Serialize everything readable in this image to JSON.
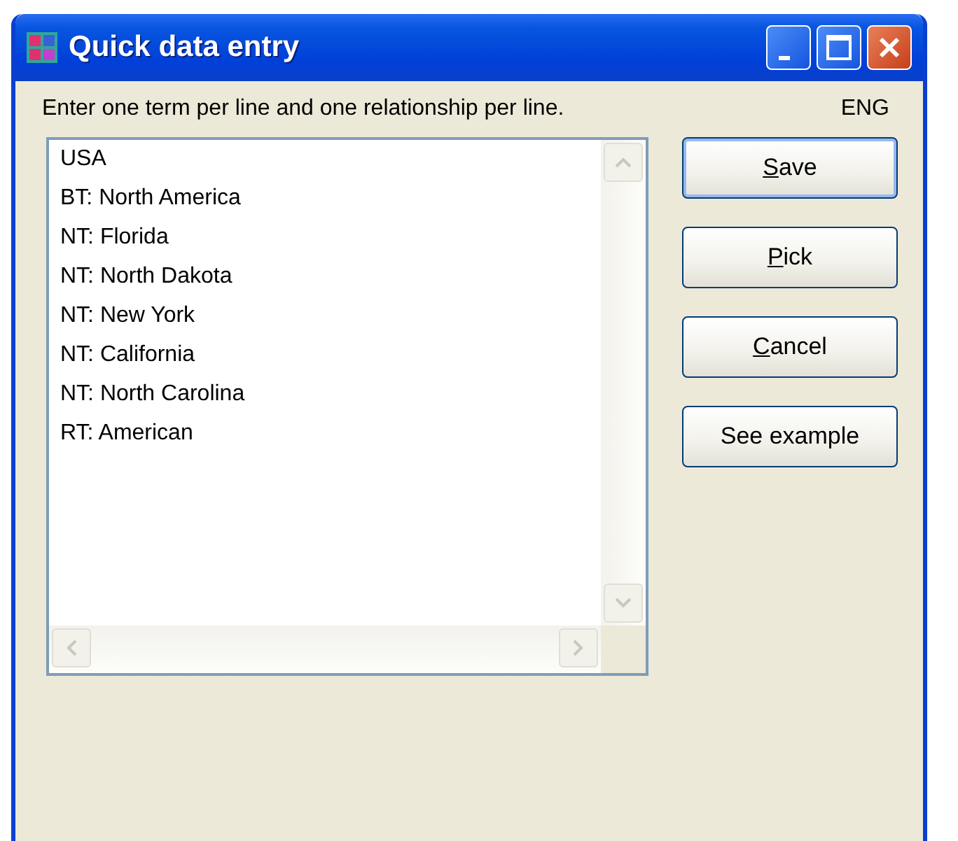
{
  "window": {
    "title": "Quick data entry"
  },
  "instruction": "Enter one term per line and one relationship per line.",
  "language": "ENG",
  "entry_lines": [
    "USA",
    "BT: North America",
    "NT: Florida",
    "NT: North Dakota",
    "NT: New York",
    "NT: California",
    "NT: North Carolina",
    "RT: American"
  ],
  "buttons": [
    {
      "label": "Save",
      "first_letter_underlined": true,
      "default": true
    },
    {
      "label": "Pick",
      "first_letter_underlined": true,
      "default": false
    },
    {
      "label": "Cancel",
      "first_letter_underlined": true,
      "default": false
    },
    {
      "label": "See example",
      "first_letter_underlined": false,
      "default": false
    }
  ]
}
